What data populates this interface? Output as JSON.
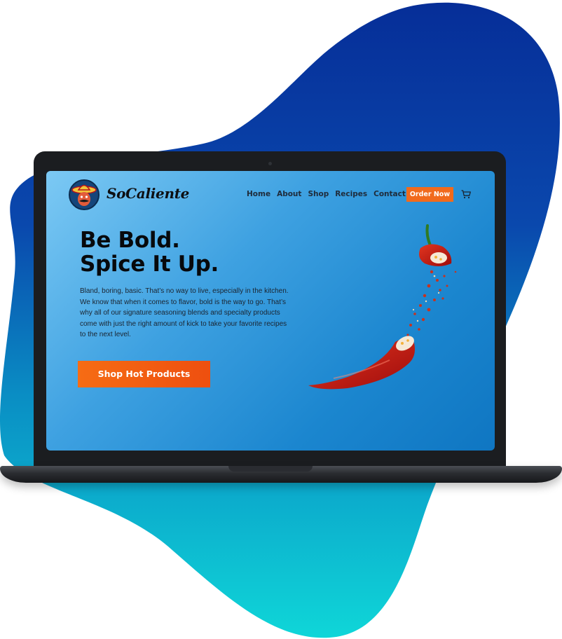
{
  "site": {
    "brand": "SoCaliente",
    "nav": [
      {
        "label": "Home"
      },
      {
        "label": "About"
      },
      {
        "label": "Shop"
      },
      {
        "label": "Recipes"
      },
      {
        "label": "Contact"
      }
    ],
    "order_button": "Order Now",
    "icons": {
      "logo": "mascot-logo-icon",
      "cart": "cart-icon"
    }
  },
  "hero": {
    "headline_line1": "Be Bold.",
    "headline_line2": "Spice It Up.",
    "body": "Bland, boring, basic. That’s no way to live, especially in the kitchen. We know that when it comes to flavor, bold is the way to go. That’s why all of our signature seasoning blends and specialty products come with just the right amount of kick to take your favorite recipes to the next level.",
    "cta": "Shop Hot Products"
  },
  "colors": {
    "accent": "#f16a1c",
    "screen_bg_start": "#7cc9f4",
    "screen_bg_end": "#0f76c2",
    "blob_top": "#062e98",
    "blob_bottom": "#0fd6d8"
  }
}
